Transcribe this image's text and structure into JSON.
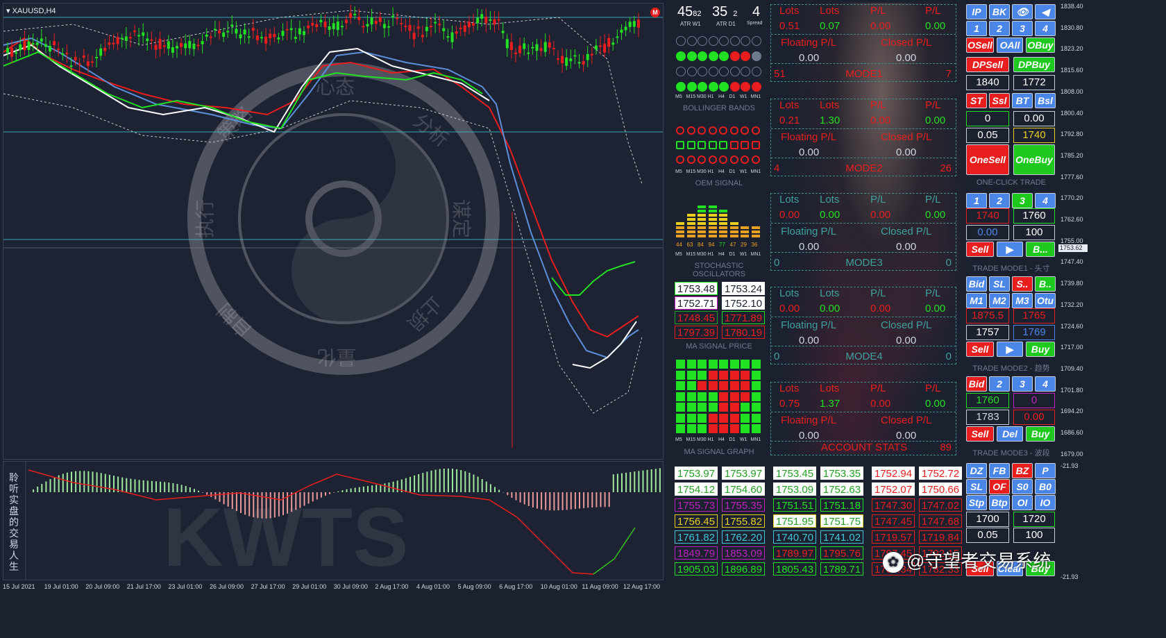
{
  "symbol": "XAUUSD,H4",
  "price_axis": [
    "1838.40",
    "1830.80",
    "1823.20",
    "1815.60",
    "1808.00",
    "1800.40",
    "1792.80",
    "1785.20",
    "1777.60",
    "1770.20",
    "1762.60",
    "1755.00",
    "1747.40",
    "1739.80",
    "1732.20",
    "1724.60",
    "1717.00",
    "1709.40",
    "1701.80",
    "1694.20",
    "1686.60",
    "1679.00"
  ],
  "current_price": "1753.62",
  "sub_axis": {
    "top": "21.93",
    "bottom": "-21.93"
  },
  "time_axis": [
    "15 Jul 2021",
    "19 Jul 01:00",
    "20 Jul 09:00",
    "21 Jul 17:00",
    "23 Jul 01:00",
    "26 Jul 09:00",
    "27 Jul 17:00",
    "29 Jul 01:00",
    "30 Jul 09:00",
    "2 Aug 17:00",
    "4 Aug 01:00",
    "5 Aug 09:00",
    "6 Aug 17:00",
    "10 Aug 01:00",
    "11 Aug 09:00",
    "12 Aug 17:00"
  ],
  "watermark": {
    "chars": [
      "心态",
      "分析",
      "谋定",
      "止损",
      "量化",
      "自制",
      "执行",
      "策略"
    ],
    "logo": "KWTS",
    "side_text": "聆听实盘的交易人生",
    "brand": "@守望者交易系统"
  },
  "atr": {
    "w1_big": "45",
    "w1_small": "82",
    "w1_label": "ATR W1",
    "d1_big": "35",
    "d1_small": "2",
    "d1_label": "ATR D1",
    "spread": "4",
    "spread_label": "Spread"
  },
  "tf_labels": [
    "M5",
    "M15",
    "M30",
    "H1",
    "H4",
    "D1",
    "W1",
    "MN1"
  ],
  "bollinger_label": "BOLLINGER BANDS",
  "oem_label": "OEM  SIGNAL",
  "stoch": {
    "values": [
      "44",
      "63",
      "84",
      "94",
      "77",
      "47",
      "29",
      "36"
    ],
    "label": "STOCHASTIC OSCILLATORS"
  },
  "ma_prices": {
    "label": "MA SIGNAL PRICE",
    "rows": [
      [
        "1753.48",
        "1753.24"
      ],
      [
        "1752.71",
        "1752.10"
      ],
      [
        "1748.45",
        "1771.89"
      ],
      [
        "1797.39",
        "1780.19"
      ]
    ]
  },
  "ma_graph_label": "MA SIGNAL GRAPH",
  "modes": [
    {
      "lots_a": "0.51",
      "lots_b": "0.07",
      "pl_a": "0.00",
      "pl_b": "0.00",
      "float": "0.00",
      "closed": "0.00",
      "left": "51",
      "name": "MODE1",
      "right": "7"
    },
    {
      "lots_a": "0.21",
      "lots_b": "1.30",
      "pl_a": "0.00",
      "pl_b": "0.00",
      "float": "0.00",
      "closed": "0.00",
      "left": "4",
      "name": "MODE2",
      "right": "26"
    },
    {
      "lots_a": "0.00",
      "lots_b": "0.00",
      "pl_a": "0.00",
      "pl_b": "0.00",
      "float": "0.00",
      "closed": "0.00",
      "left": "0",
      "name": "MODE3",
      "right": "0"
    },
    {
      "lots_a": "0.00",
      "lots_b": "0.00",
      "pl_a": "0.00",
      "pl_b": "0.00",
      "float": "0.00",
      "closed": "0.00",
      "left": "0",
      "name": "MODE4",
      "right": "0"
    },
    {
      "lots_a": "0.75",
      "lots_b": "1.37",
      "pl_a": "0.00",
      "pl_b": "0.00",
      "float": "0.00",
      "closed": "0.00",
      "left": "",
      "name": "ACCOUNT STATS",
      "right": "89"
    }
  ],
  "mode_headers": {
    "lots": "Lots",
    "pl": "P/L",
    "floating": "Floating P/L",
    "closed": "Closed P/L"
  },
  "bottom_prices": {
    "col1": [
      [
        "1753.97",
        "1753.97"
      ],
      [
        "1754.12",
        "1754.60"
      ],
      [
        "1755.73",
        "1755.35"
      ],
      [
        "1756.45",
        "1755.82"
      ],
      [
        "1761.82",
        "1762.20"
      ],
      [
        "1849.79",
        "1853.09"
      ],
      [
        "1905.03",
        "1896.89"
      ]
    ],
    "col2": [
      [
        "1753.45",
        "1753.35"
      ],
      [
        "1753.09",
        "1752.63"
      ],
      [
        "1751.51",
        "1751.18"
      ],
      [
        "1751.95",
        "1751.75"
      ],
      [
        "1740.70",
        "1741.02"
      ],
      [
        "1789.97",
        "1795.76"
      ],
      [
        "1805.43",
        "1789.71"
      ]
    ],
    "col3": [
      [
        "1752.94",
        "1752.72"
      ],
      [
        "1752.07",
        "1750.66"
      ],
      [
        "1747.30",
        "1747.02"
      ],
      [
        "1747.45",
        "1747.68"
      ],
      [
        "1719.57",
        "1719.84"
      ],
      [
        "1797.45",
        "1792.15"
      ],
      [
        "1760.34",
        "1782.33"
      ]
    ]
  },
  "panel": {
    "r1": [
      "IP",
      "BK",
      "👁",
      "◀"
    ],
    "r2": [
      "1",
      "2",
      "3",
      "4"
    ],
    "osell": "OSell",
    "oall": "OAll",
    "obuy": "OBuy",
    "dpsell": "DPSell",
    "dpbuy": "DPBuy",
    "f1": [
      "1840",
      "1772"
    ],
    "r3": [
      "ST",
      "Ssl",
      "BT",
      "Bsl"
    ],
    "f2": [
      "0",
      "0.00"
    ],
    "f3": [
      "0.05",
      "1740"
    ],
    "onesell": "OneSell",
    "onebuy": "OneBuy",
    "oneclick_label": "ONE-CLICK  TRADE",
    "r4": [
      "1",
      "2",
      "3",
      "4"
    ],
    "f4": [
      "1740",
      "1760"
    ],
    "f5": [
      "0.00",
      "100"
    ],
    "sell": "Sell",
    "b_short": "B...",
    "m1_label": "TRADE MODE1 - 头寸",
    "r5": [
      "Bid",
      "SL",
      "S..",
      "B.."
    ],
    "r6": [
      "M1",
      "M2",
      "M3",
      "Otu"
    ],
    "f6": [
      "1875.5",
      "1765"
    ],
    "f7": [
      "1757",
      "1769"
    ],
    "buy": "Buy",
    "m2_label": "TRADE MODE2 - 趋势",
    "r7": [
      "Bid",
      "2",
      "3",
      "4"
    ],
    "f8": [
      "1760",
      "0"
    ],
    "f9": [
      "1783",
      "0.00"
    ],
    "del": "Del",
    "m3_label": "TRADE MODE3 - 波段",
    "r8": [
      "DZ",
      "FB",
      "BZ",
      "P"
    ],
    "r9": [
      "SL",
      "OF",
      "S0",
      "B0"
    ],
    "r10": [
      "Stp",
      "Btp",
      "OI",
      "IO"
    ],
    "f10": [
      "1700",
      "1720"
    ],
    "f11": [
      "0.05",
      "100"
    ],
    "r11": [
      "Sell",
      "Clear",
      "Buy"
    ]
  }
}
